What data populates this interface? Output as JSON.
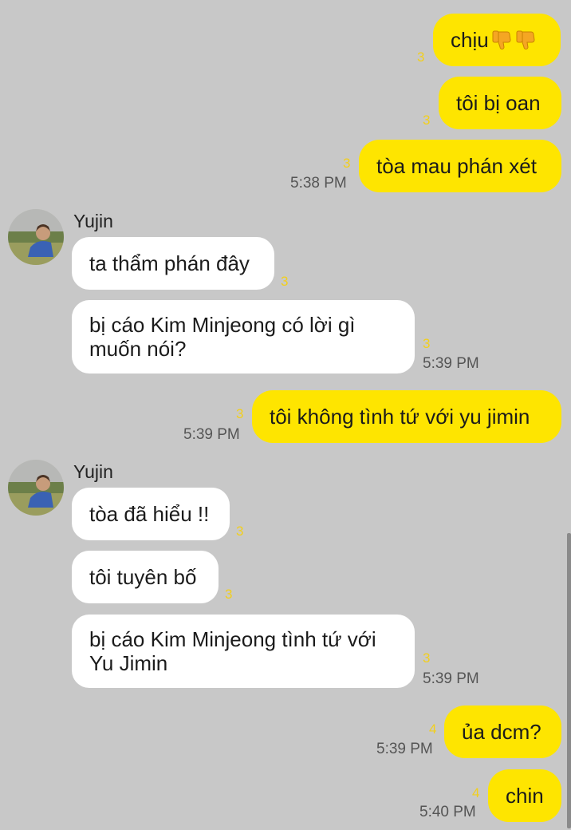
{
  "messages": [
    {
      "kind": "out",
      "text": "chịu",
      "icons": [
        "thumbs-down-icon",
        "thumbs-down-icon"
      ],
      "unread": "3"
    },
    {
      "kind": "out",
      "text": "tôi bị oan",
      "unread": "3"
    },
    {
      "kind": "out",
      "text": "tòa mau phán xét",
      "unread": "3",
      "time": "5:38 PM"
    },
    {
      "kind": "sender",
      "name": "Yujin"
    },
    {
      "kind": "in",
      "text": "ta thẩm phán đây",
      "unread": "3"
    },
    {
      "kind": "in",
      "text": "bị cáo Kim Minjeong có lời gì muốn nói?",
      "unread": "3",
      "time": "5:39 PM"
    },
    {
      "kind": "out",
      "text": "tôi không tình tứ với yu jimin",
      "unread": "3",
      "time": "5:39 PM"
    },
    {
      "kind": "sender",
      "name": "Yujin"
    },
    {
      "kind": "in",
      "text": "tòa đã hiểu !!",
      "unread": "3"
    },
    {
      "kind": "in",
      "text": "tôi tuyên bố",
      "unread": "3"
    },
    {
      "kind": "in",
      "text": "bị cáo Kim Minjeong tình tứ với Yu Jimin",
      "unread": "3",
      "time": "5:39 PM"
    },
    {
      "kind": "out",
      "text": "ủa dcm?",
      "unread": "4",
      "time": "5:39 PM"
    },
    {
      "kind": "out",
      "text": "chin",
      "unread": "4",
      "time": "5:40 PM"
    }
  ],
  "colors": {
    "background": "#c8c8c8",
    "outgoing_bubble": "#fee500",
    "incoming_bubble": "#ffffff",
    "unread_count": "#f2cf1d"
  }
}
